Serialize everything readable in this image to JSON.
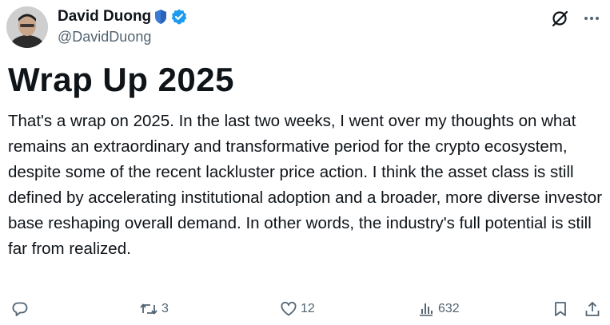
{
  "author": {
    "name": "David Duong",
    "handle": "@DavidDuong",
    "verified": true
  },
  "post": {
    "title": "Wrap Up 2025",
    "body": "That's a wrap on 2025. In the last two weeks, I went over my thoughts on what remains an extraordinary and transformative period for the crypto ecosystem, despite some of the recent lackluster price action. I think the asset class is still defined by accelerating institutional adoption and a broader, more diverse investor base reshaping overall demand. In other words, the industry's full potential is still far from realized."
  },
  "engagement": {
    "replies": "",
    "reposts": "3",
    "likes": "12",
    "views": "632"
  },
  "colors": {
    "verified_blue": "#1d9bf0",
    "shield_blue": "#3a7bd5",
    "icon_gray": "#536471",
    "text": "#0f1419"
  }
}
